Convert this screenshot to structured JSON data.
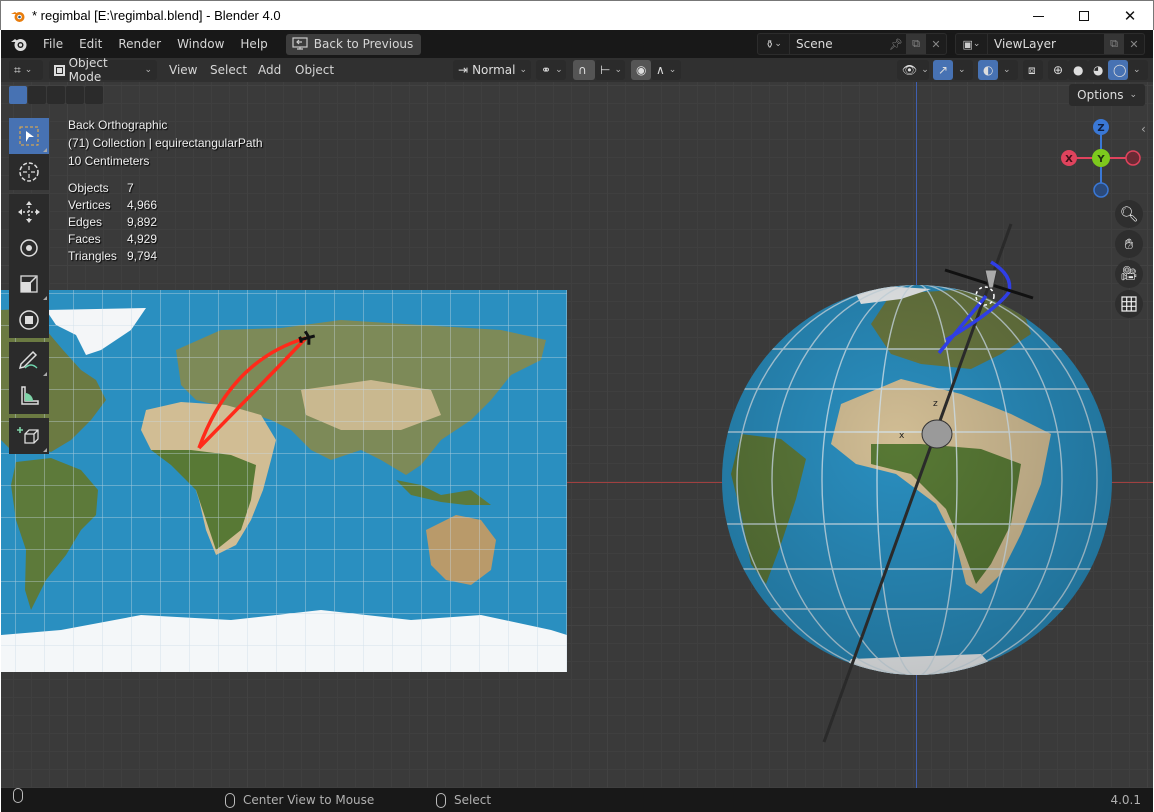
{
  "window": {
    "title": "* regimbal [E:\\regimbal.blend] - Blender 4.0",
    "controls": {
      "minimize": "—",
      "maximize": "☐",
      "close": "✕"
    }
  },
  "menubar": {
    "items": [
      "File",
      "Edit",
      "Render",
      "Window",
      "Help"
    ],
    "back_button": "Back to Previous",
    "scene": {
      "name": "Scene"
    },
    "view_layer": {
      "name": "ViewLayer"
    }
  },
  "viewport_header": {
    "editor_type_icon": "editor-type-icon",
    "mode": "Object Mode",
    "menus": [
      "View",
      "Select",
      "Add",
      "Object"
    ],
    "orientation": "Normal",
    "options_label": "Options"
  },
  "overlay_text": {
    "view_name": "Back Orthographic",
    "collection": "(71) Collection | equirectangularPath",
    "scale": "10 Centimeters"
  },
  "stats": [
    {
      "label": "Objects",
      "value": "7"
    },
    {
      "label": "Vertices",
      "value": "4,966"
    },
    {
      "label": "Edges",
      "value": "9,892"
    },
    {
      "label": "Faces",
      "value": "4,929"
    },
    {
      "label": "Triangles",
      "value": "9,794"
    }
  ],
  "toolbar": {
    "tools": [
      "select-box",
      "cursor",
      "move",
      "rotate",
      "scale",
      "transform",
      "annotate",
      "measure",
      "add-cube"
    ],
    "active": "select-box"
  },
  "gizmo": {
    "x": "X",
    "y": "Y",
    "z": "Z"
  },
  "colors": {
    "accent": "#4772b3",
    "axis_x": "#e0435d",
    "axis_y": "#7dc91d",
    "axis_z": "#3a78d6",
    "path_map": "#ff2a1a",
    "path_globe": "#2f3ee6"
  },
  "statusbar": {
    "middle_action": "Center View to Mouse",
    "right_action": "Select",
    "version": "4.0.1"
  }
}
